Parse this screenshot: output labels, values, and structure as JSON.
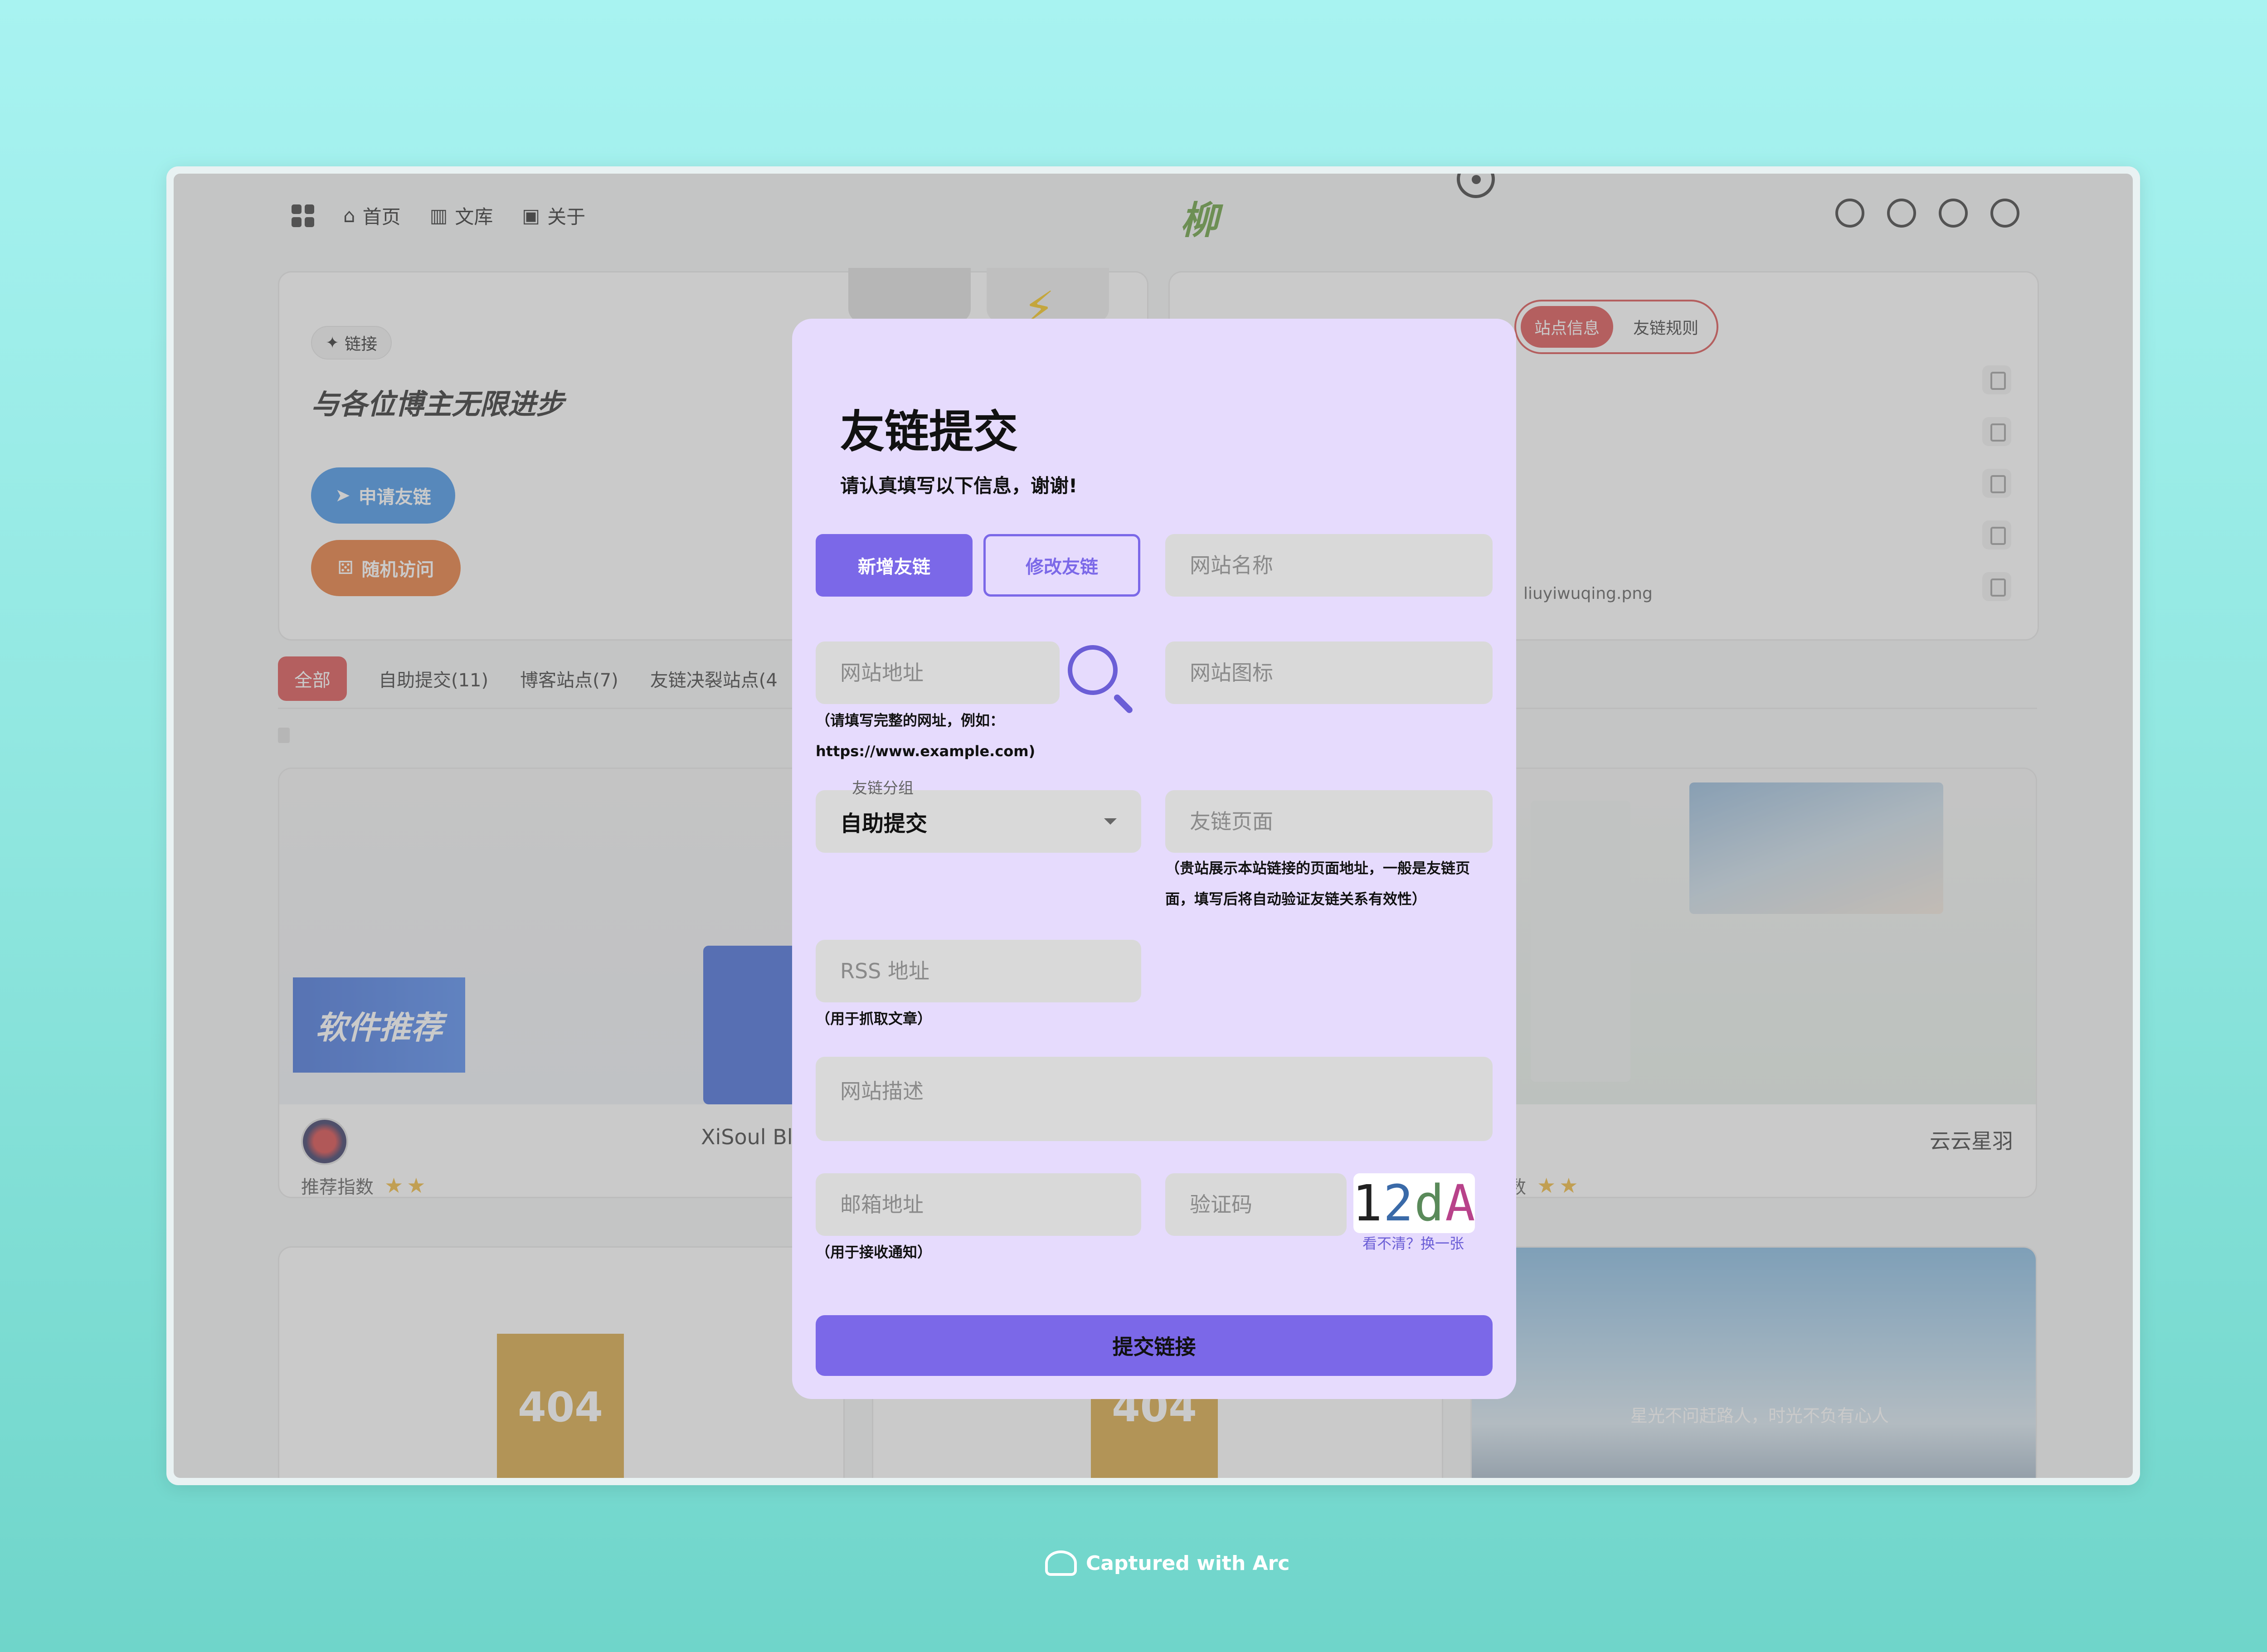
{
  "nav": {
    "items": [
      {
        "label": "首页"
      },
      {
        "label": "文库"
      },
      {
        "label": "关于"
      }
    ],
    "logo": "柳"
  },
  "hero": {
    "tag": "链接",
    "title": "与各位博主无限进步",
    "apply_button": "申请友链",
    "random_button": "随机访问"
  },
  "info": {
    "tabs": [
      "站点信息",
      "友链规则"
    ],
    "file_fragment": "liuyiwuqing.png"
  },
  "filters": [
    {
      "label": "全部",
      "active": true
    },
    {
      "label": "自助提交(11)"
    },
    {
      "label": "博客站点(7)"
    },
    {
      "label": "友链决裂站点(4"
    }
  ],
  "cards": {
    "card1": {
      "name": "XiSoul Blo",
      "rec_label": "推荐指数",
      "stars": "★★",
      "banner": "软件推荐"
    },
    "card3": {
      "name": "云云星羽",
      "rec_label": "荐指数",
      "stars": "★★"
    },
    "bottom": {
      "file404": "404",
      "sky_text": "星光不问赶路人，时光不负有心人"
    }
  },
  "modal": {
    "title": "友链提交",
    "subtitle": "请认真填写以下信息，谢谢!",
    "btn_new": "新增友链",
    "btn_edit": "修改友链",
    "fields": {
      "site_name": "网站名称",
      "site_url": "网站地址",
      "site_icon": "网站图标",
      "friend_page": "友链页面",
      "rss": "RSS 地址",
      "description": "网站描述",
      "email": "邮箱地址",
      "captcha": "验证码"
    },
    "hints": {
      "url_line1": "（请填写完整的网址，例如：",
      "url_line2": "https://www.example.com)",
      "friend_page_line1": "（贵站展示本站链接的页面地址，一般是友链页",
      "friend_page_line2": "面，填写后将自动验证友链关系有效性）",
      "rss": "（用于抓取文章）",
      "email": "（用于接收通知）"
    },
    "group_label": "友链分组",
    "group_value": "自助提交",
    "captcha_chars": [
      "1",
      "2",
      "d",
      "A"
    ],
    "captcha_refresh": "看不清？换一张",
    "submit": "提交链接"
  },
  "caption": "Captured with Arc",
  "colors": {
    "accent": "#7b68e8",
    "modal_bg": "#e6dbfd",
    "red": "#d94848"
  }
}
